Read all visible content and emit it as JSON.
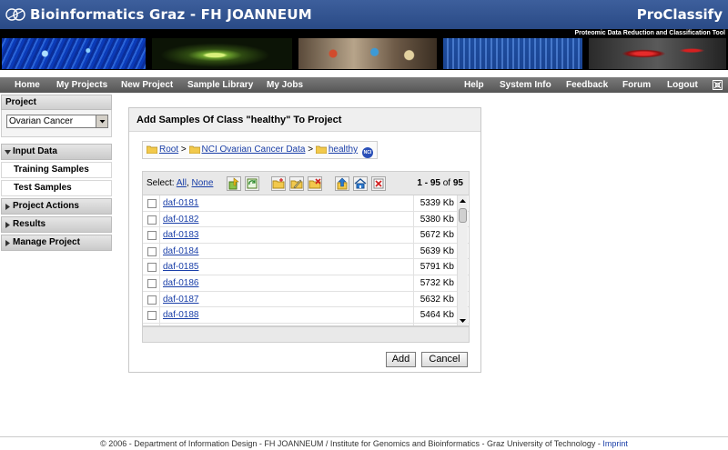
{
  "header": {
    "site_title": "Bioinformatics Graz - FH JOANNEUM",
    "app_title": "ProClassify",
    "subtitle": "Proteomic Data Reduction and Classification Tool"
  },
  "nav": {
    "left": [
      "Home",
      "My Projects",
      "New Project",
      "Sample Library",
      "My Jobs"
    ],
    "right": [
      "Help",
      "System Info",
      "Feedback",
      "Forum",
      "Logout"
    ]
  },
  "sidebar": {
    "project_label": "Project",
    "project_selected": "Ovarian Cancer",
    "sections": {
      "input_data": "Input Data",
      "training_samples": "Training Samples",
      "test_samples": "Test Samples",
      "project_actions": "Project Actions",
      "results": "Results",
      "manage_project": "Manage Project"
    }
  },
  "panel": {
    "title": "Add Samples Of Class \"healthy\" To Project",
    "breadcrumb": [
      "Root",
      "NCI Ovarian Cancer Data",
      "healthy"
    ],
    "breadcrumb_sep": ">",
    "ncbi_badge": "NCI",
    "select_label": "Select:",
    "select_all": "All",
    "select_none": "None",
    "count_range": "1 - 95",
    "count_of": "of",
    "count_total": "95",
    "rows": [
      {
        "name": "daf-0181",
        "size": "5339 Kb"
      },
      {
        "name": "daf-0182",
        "size": "5380 Kb"
      },
      {
        "name": "daf-0183",
        "size": "5672 Kb"
      },
      {
        "name": "daf-0184",
        "size": "5639 Kb"
      },
      {
        "name": "daf-0185",
        "size": "5791 Kb"
      },
      {
        "name": "daf-0186",
        "size": "5732 Kb"
      },
      {
        "name": "daf-0187",
        "size": "5632 Kb"
      },
      {
        "name": "daf-0188",
        "size": "5464 Kb"
      }
    ],
    "add_label": "Add",
    "cancel_label": "Cancel"
  },
  "footer": {
    "text": "© 2006 - Department of Information Design - FH JOANNEUM  /  Institute for Genomics and Bioinformatics - Graz University of Technology - ",
    "imprint": "Imprint"
  }
}
